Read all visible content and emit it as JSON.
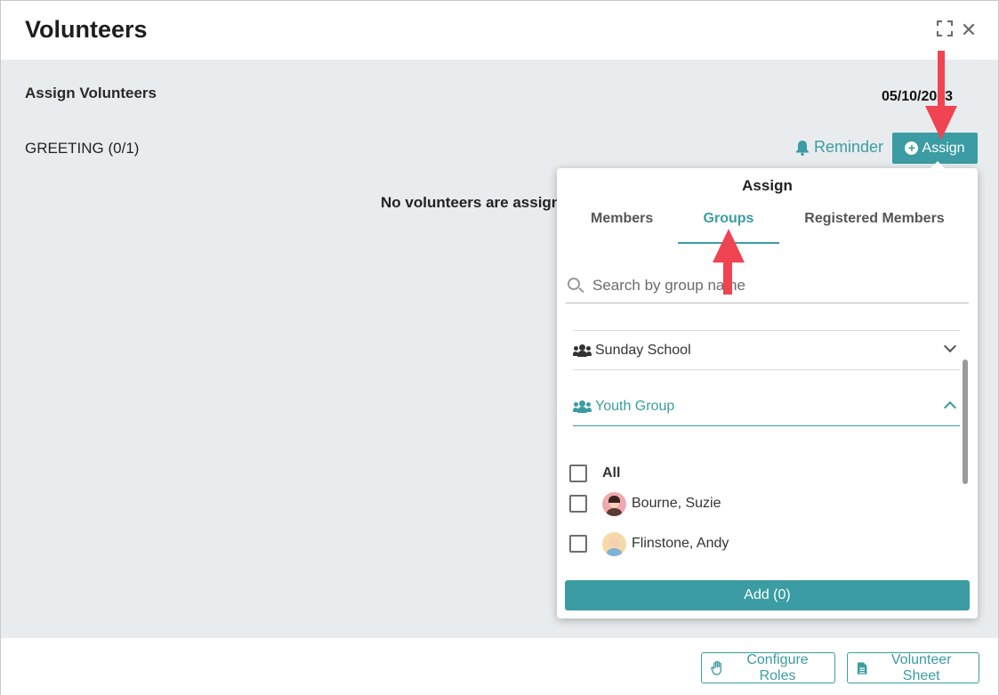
{
  "dialog": {
    "title": "Volunteers"
  },
  "body": {
    "section_title": "Assign Volunteers",
    "date": "05/10/2023",
    "role_label": "GREETING (0/1)",
    "reminder_label": "Reminder",
    "assign_label": "Assign",
    "empty_message": "No volunteers are assigned"
  },
  "popover": {
    "title": "Assign",
    "tabs": [
      {
        "label": "Members"
      },
      {
        "label": "Groups",
        "active": true
      },
      {
        "label": "Registered Members"
      }
    ],
    "search": {
      "placeholder": "Search by group name",
      "value": ""
    },
    "groups": [
      {
        "name": "Sunday School",
        "expanded": false
      },
      {
        "name": "Youth Group",
        "expanded": true
      }
    ],
    "members": [
      {
        "label": "All",
        "checked": false
      },
      {
        "label": "Bourne, Suzie",
        "checked": false
      },
      {
        "label": "Flinstone, Andy",
        "checked": false
      }
    ],
    "add_label": "Add (0)"
  },
  "footer": {
    "configure_label": "Configure Roles",
    "sheet_label": "Volunteer Sheet"
  },
  "colors": {
    "accent": "#3b9ca3",
    "annotation_arrow": "#f04452",
    "body_bg": "#e9ecee"
  }
}
